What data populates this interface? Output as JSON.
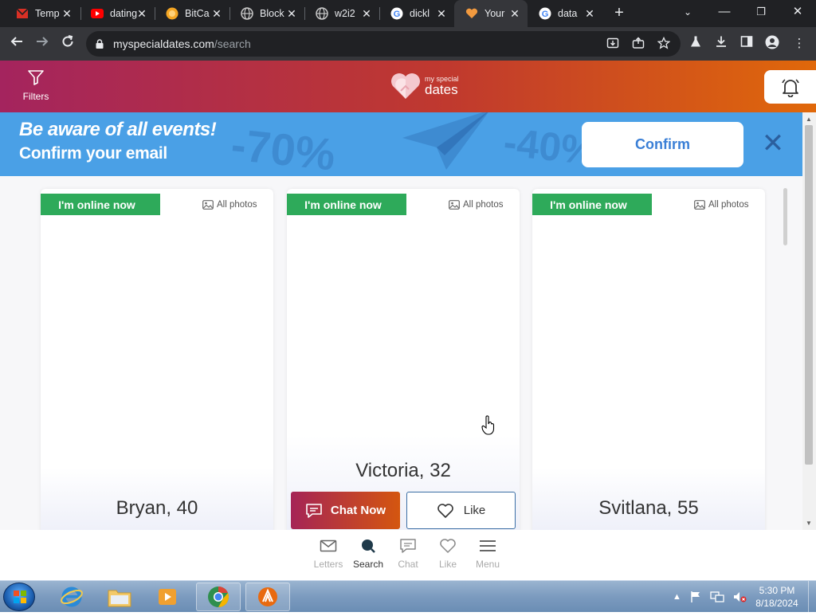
{
  "browser": {
    "tabs": [
      {
        "title": "Temp",
        "favicon": "mail-icon",
        "color": "#d93025"
      },
      {
        "title": "dating",
        "favicon": "youtube-icon",
        "color": "#ff0000"
      },
      {
        "title": "BitCa",
        "favicon": "bitcoin-icon",
        "color": "#f5a623"
      },
      {
        "title": "Block",
        "favicon": "globe-icon",
        "color": "#9aa0a6"
      },
      {
        "title": "w2i2",
        "favicon": "globe-icon",
        "color": "#9aa0a6"
      },
      {
        "title": "dickl",
        "favicon": "google-icon",
        "color": "#4285f4"
      },
      {
        "title": "Your",
        "favicon": "heart-icon",
        "color": "#f29a3f",
        "active": true
      },
      {
        "title": "data",
        "favicon": "google-icon",
        "color": "#4285f4"
      }
    ],
    "url_host": "myspecialdates.com",
    "url_path": "/search"
  },
  "header": {
    "filters_label": "Filters",
    "logo_small": "my special",
    "logo_big": "dates"
  },
  "banner": {
    "title": "Be aware of all events!",
    "subtitle": "Confirm your email",
    "confirm_label": "Confirm",
    "deco1": "-70%",
    "deco2": "-40%"
  },
  "cards": [
    {
      "status": "I'm online now",
      "photos": "All photos",
      "name": "Bryan, 40"
    },
    {
      "status": "I'm online now",
      "photos": "All photos",
      "name": "Victoria, 32",
      "chat": "Chat Now",
      "like": "Like"
    },
    {
      "status": "I'm online now",
      "photos": "All photos",
      "name": "Svitlana, 55"
    }
  ],
  "bottom_nav": [
    {
      "label": "Letters",
      "icon": "envelope-icon"
    },
    {
      "label": "Search",
      "icon": "search-icon",
      "active": true
    },
    {
      "label": "Chat",
      "icon": "chat-icon"
    },
    {
      "label": "Like",
      "icon": "heart-icon"
    },
    {
      "label": "Menu",
      "icon": "menu-icon"
    }
  ],
  "taskbar": {
    "time": "5:30 PM",
    "date": "8/18/2024"
  }
}
